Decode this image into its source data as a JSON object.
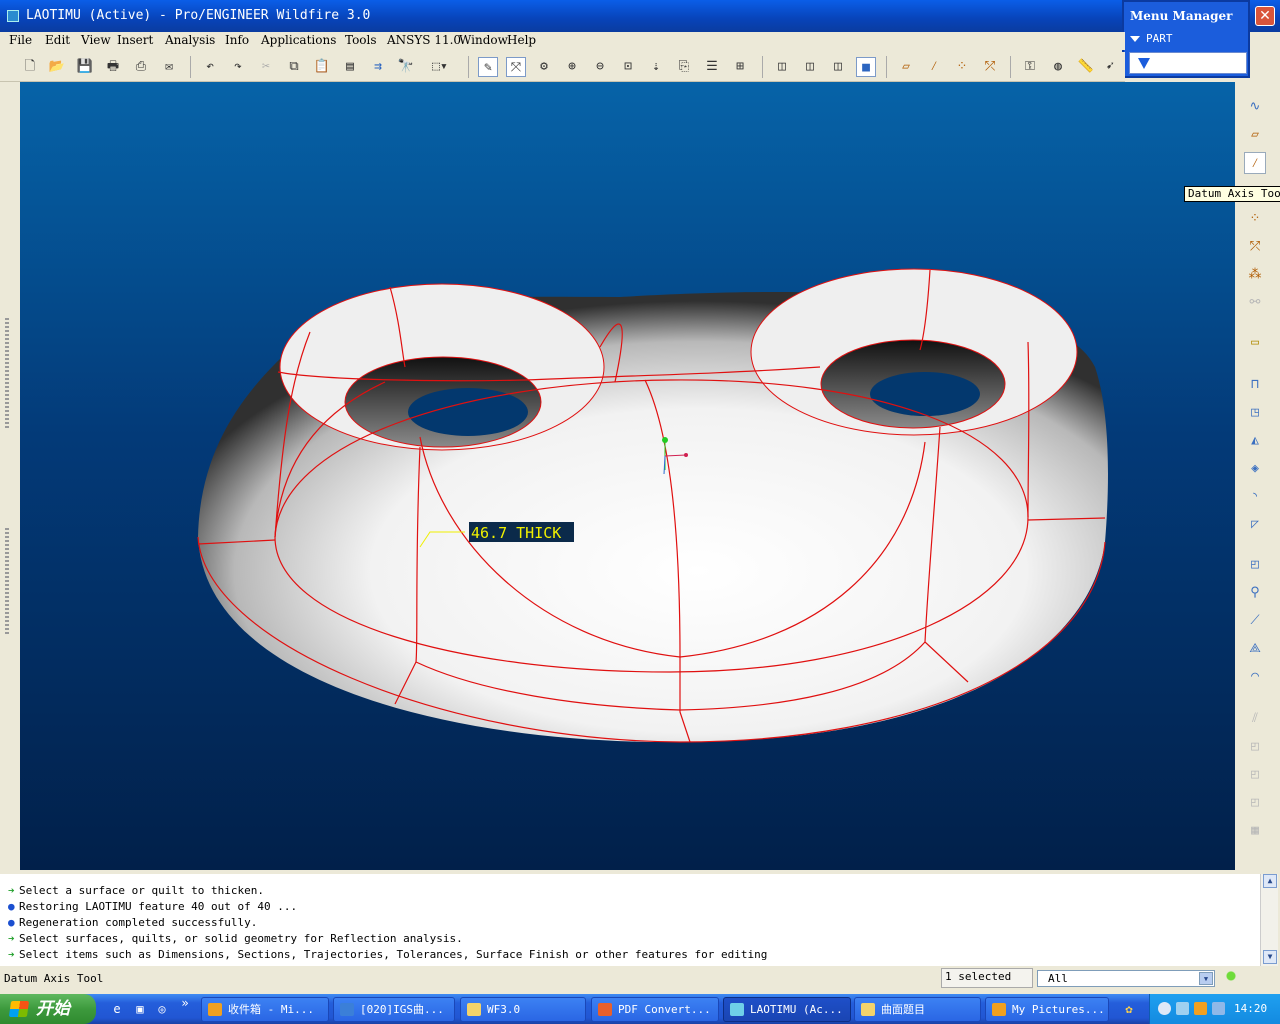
{
  "window": {
    "title": "LAOTIMU (Active) - Pro/ENGINEER Wildfire 3.0",
    "close_glyph": "✕"
  },
  "menu": [
    "File",
    "Edit",
    "View",
    "Insert",
    "Analysis",
    "Info",
    "Applications",
    "Tools",
    "ANSYS 11.0",
    "Window",
    "Help"
  ],
  "menu_manager": {
    "title": "Menu Manager",
    "item": "PART"
  },
  "tooltip": "Datum Axis Tool",
  "annotation": "46.7 THICK",
  "messages": [
    {
      "marker": "arrow",
      "text": "Select a surface or quilt to thicken."
    },
    {
      "marker": "dot",
      "text": "Restoring LAOTIMU feature 40 out of 40 ..."
    },
    {
      "marker": "dot",
      "text": "Regeneration completed successfully."
    },
    {
      "marker": "arrow",
      "text": "Select surfaces, quilts, or solid geometry for Reflection analysis."
    },
    {
      "marker": "arrow",
      "text": "Select items such as Dimensions, Sections, Trajectories, Tolerances, Surface Finish or other features for editing"
    }
  ],
  "status": {
    "left": "Datum Axis Tool",
    "selected": "1 selected",
    "filter": "All"
  },
  "taskbar": {
    "start": "开始",
    "more": "»",
    "tasks": [
      {
        "label": "收件箱 - Mi...",
        "color": "#f0a020"
      },
      {
        "label": "[020]IGS曲...",
        "color": "#3b7fd8"
      },
      {
        "label": "WF3.0",
        "color": "#f3d36b"
      },
      {
        "label": "PDF Convert...",
        "color": "#e8602c"
      },
      {
        "label": "LAOTIMU (Ac...",
        "color": "#6fd0e8"
      },
      {
        "label": "曲面题目",
        "color": "#f3d36b"
      },
      {
        "label": "My Pictures...",
        "color": "#f0a020"
      }
    ],
    "time": "14:20"
  },
  "colors": {
    "viewport_top": "#0663a8",
    "viewport_bottom": "#01204a",
    "edge_red": "#e01010",
    "annotation_bg": "#0b2a4a",
    "annotation_fg": "#f0f000"
  },
  "toolbar_icons": [
    "new-icon",
    "open-icon",
    "save-icon",
    "print-icon",
    "print-preview-icon",
    "send-icon",
    "undo-icon",
    "redo-icon",
    "cut-icon",
    "copy-icon",
    "paste-icon",
    "paste-special-icon",
    "regenerate-icon",
    "find-icon",
    "selection-box-icon",
    "repaint-icon",
    "spin-center-icon",
    "orient-icon",
    "zoom-in-icon",
    "zoom-out-icon",
    "refit-icon",
    "reorient-icon",
    "view-manager-icon",
    "layers-icon",
    "model-tree-icon",
    "wireframe-icon",
    "hidden-line-icon",
    "no-hidden-icon",
    "shading-icon",
    "datum-plane-display-icon",
    "datum-axis-display-icon",
    "point-display-icon",
    "csys-display-icon",
    "model-check-icon",
    "analysis-icon",
    "measure-icon",
    "pointer-icon"
  ],
  "right_icons": [
    "sketch-curve-icon",
    "datum-plane-icon",
    "datum-axis-icon",
    "datum-point-icon",
    "csys-icon",
    "point-offset-icon",
    "analysis-feature-icon",
    "sketch-tool-icon",
    "extrude-icon",
    "revolve-icon",
    "variable-sweep-icon",
    "blend-icon",
    "round-icon",
    "chamfer-icon",
    "hole-icon",
    "shell-icon",
    "rib-icon",
    "draft-icon",
    "pattern-icon",
    "mirror-icon",
    "merge-icon",
    "trim-icon",
    "extend-icon",
    "offset-icon",
    "thicken-icon",
    "solidify-icon"
  ]
}
